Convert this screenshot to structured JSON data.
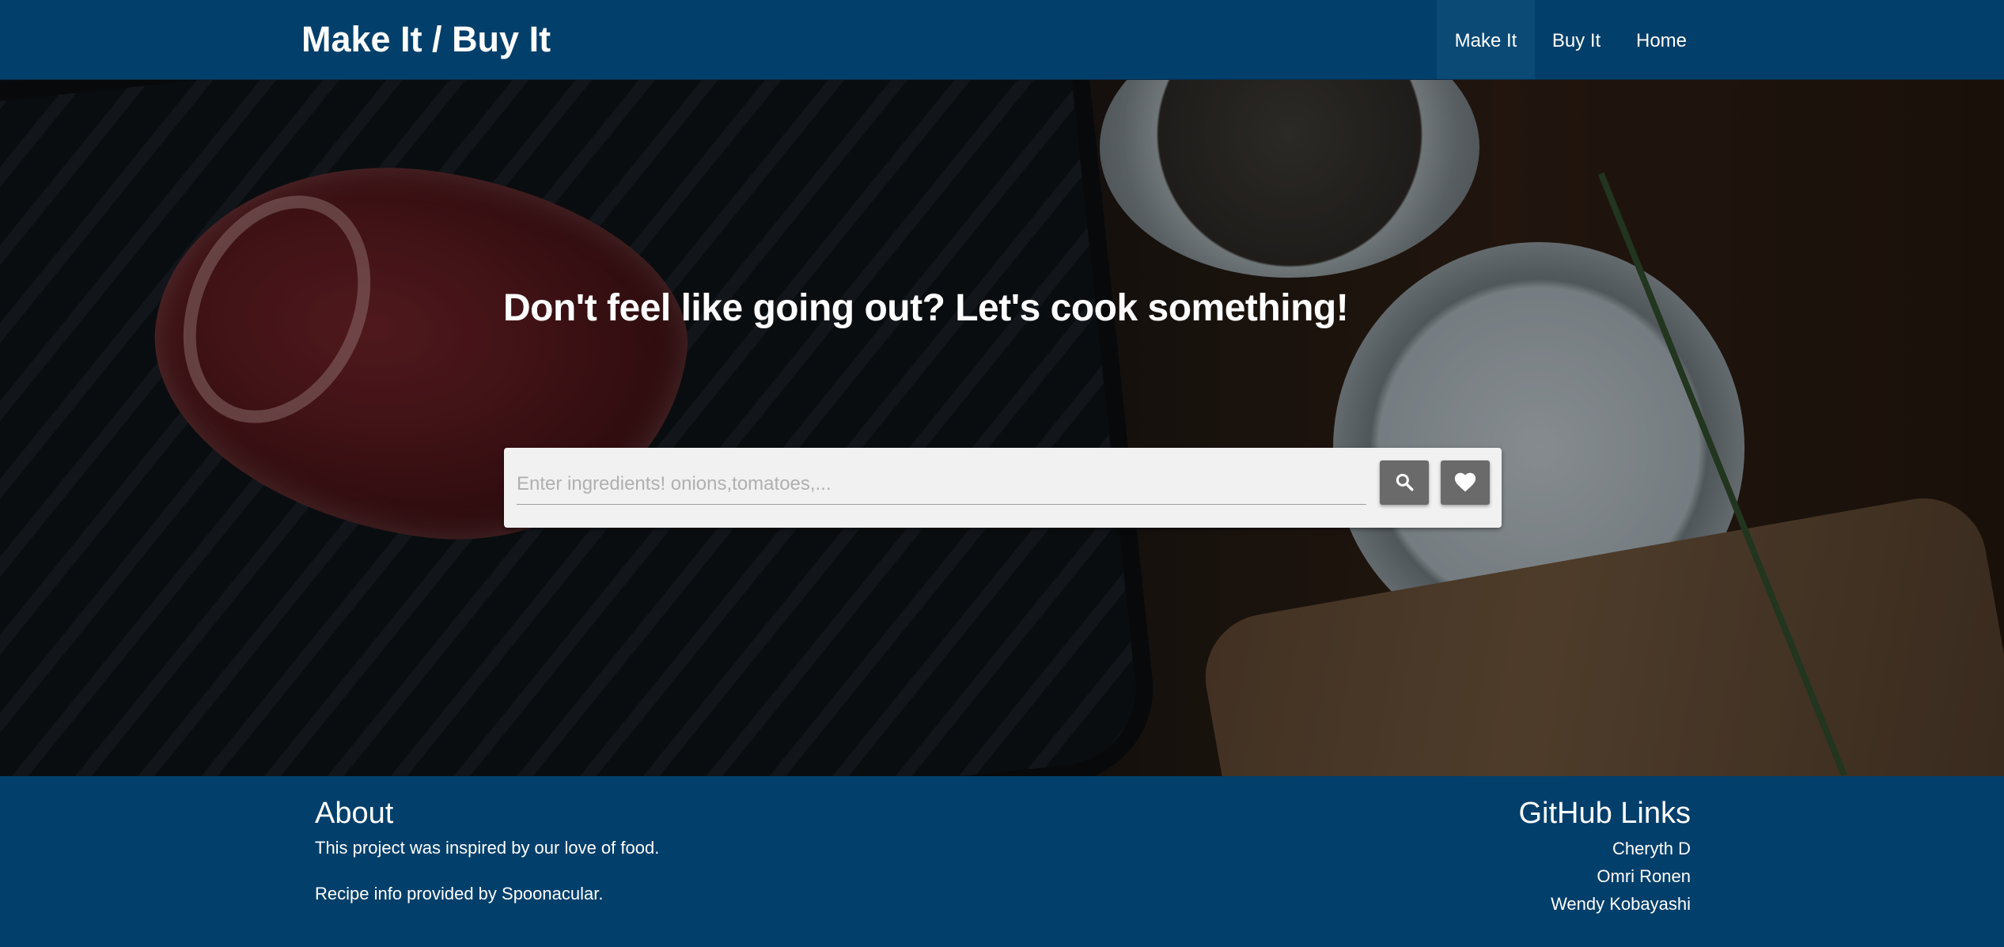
{
  "navbar": {
    "brand": "Make It / Buy It",
    "links": [
      {
        "label": "Make It",
        "active": true
      },
      {
        "label": "Buy It",
        "active": false
      },
      {
        "label": "Home",
        "active": false
      }
    ]
  },
  "hero": {
    "title": "Don't feel like going out? Let's cook something!",
    "search": {
      "placeholder": "Enter ingredients! onions,tomatoes,...",
      "value": "",
      "search_icon": "search-icon",
      "favorites_icon": "heart-icon"
    }
  },
  "footer": {
    "about": {
      "heading": "About",
      "lines": [
        "This project was inspired by our love of food.",
        "Recipe info provided by Spoonacular."
      ]
    },
    "github": {
      "heading": "GitHub Links",
      "links": [
        "Cheryth D",
        "Omri Ronen",
        "Wendy Kobayashi"
      ]
    }
  },
  "colors": {
    "navbar_bg": "#033f6b",
    "footer_bg": "#033f6b",
    "search_card_bg": "#f1f1f1",
    "icon_button_bg": "#6a6a6a"
  }
}
